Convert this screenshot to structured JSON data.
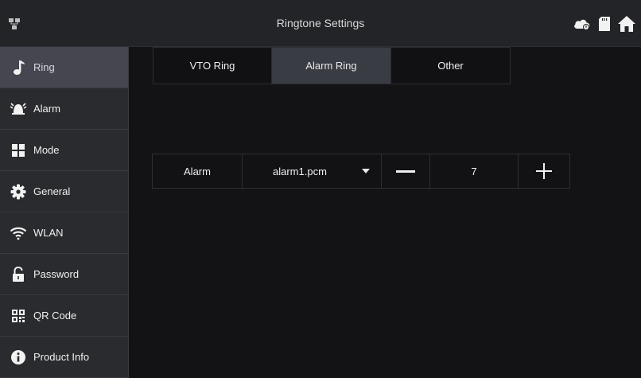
{
  "header": {
    "title": "Ringtone Settings",
    "left_icon": "network-icon",
    "right_icons": [
      "cloud-icon",
      "sd-card-icon",
      "home-icon"
    ]
  },
  "sidebar": {
    "items": [
      {
        "label": "Ring",
        "icon": "music-note-icon",
        "active": true
      },
      {
        "label": "Alarm",
        "icon": "alarm-icon",
        "active": false
      },
      {
        "label": "Mode",
        "icon": "mode-icon",
        "active": false
      },
      {
        "label": "General",
        "icon": "gear-icon",
        "active": false
      },
      {
        "label": "WLAN",
        "icon": "wifi-icon",
        "active": false
      },
      {
        "label": "Password",
        "icon": "lock-icon",
        "active": false
      },
      {
        "label": "QR Code",
        "icon": "qr-code-icon",
        "active": false
      },
      {
        "label": "Product Info",
        "icon": "info-icon",
        "active": false
      }
    ]
  },
  "main": {
    "tabs": [
      {
        "label": "VTO Ring",
        "active": false
      },
      {
        "label": "Alarm Ring",
        "active": true
      },
      {
        "label": "Other",
        "active": false
      }
    ],
    "ring_row": {
      "name": "Alarm",
      "selected_file": "alarm1.pcm",
      "volume": "7"
    }
  },
  "colors": {
    "background": "#131315",
    "topbar": "#232427",
    "sidebar": "#2a2b2e",
    "active_item": "#454650",
    "active_tab": "#3a3c44",
    "text": "#f0f0f0"
  }
}
